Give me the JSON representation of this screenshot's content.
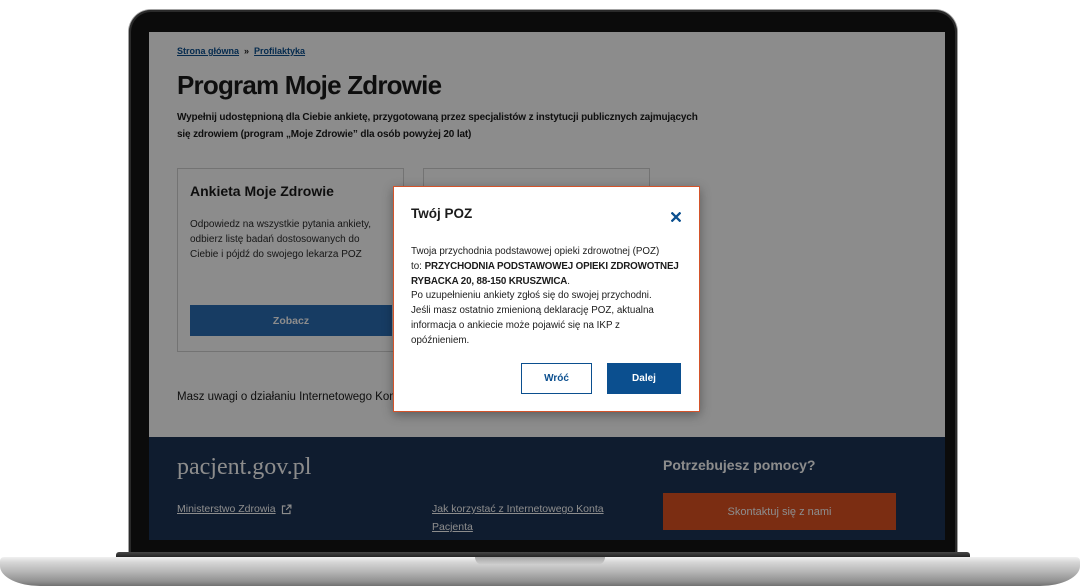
{
  "breadcrumb": {
    "home": "Strona główna",
    "separator": "»",
    "current": "Profilaktyka"
  },
  "page": {
    "title": "Program Moje Zdrowie",
    "subtitle_lines": [
      "Wypełnij udostępnioną dla Ciebie ankietę, przygotowaną przez specjalistów z instytucji publicznych zajmujących",
      "się zdrowiem (program „Moje Zdrowie” dla osób powyżej 20 lat)"
    ],
    "cards": [
      {
        "title": "Ankieta Moje Zdrowie",
        "description": "Odpowiedz na wszystkie pytania ankiety, odbierz listę badań dostosowanych do Ciebie i pójdź do swojego lekarza POZ",
        "button_label": "Zobacz"
      }
    ],
    "feedback_text": "Masz uwagi o działaniu Internetowego Kon"
  },
  "footer": {
    "logo_text": "pacjent.gov.pl",
    "ministry_link": "Ministerstwo Zdrowia",
    "help_link": "Jak korzystać z Internetowego Konta Pacjenta",
    "help_heading": "Potrzebujesz pomocy?",
    "contact_button_label": "Skontaktuj się z nami"
  },
  "modal": {
    "title": "Twój POZ",
    "body": {
      "line1": "Twoja przychodnia podstawowej opieki zdrowotnej (POZ)",
      "to_prefix": "to:",
      "clinic_name": "PRZYCHODNIA PODSTAWOWEJ OPIEKI ZDROWOTNEJ",
      "clinic_address": "RYBACKA 20, 88-150 KRUSZWICA",
      "clinic_end": ".",
      "line4": "Po uzupełnieniu ankiety zgłoś się do swojej przychodni.",
      "line5": "Jeśli masz ostatnio zmienioną deklarację POZ, aktualna",
      "line6": "informacja o ankiecie może pojawić się na IKP z",
      "line7": "opóźnieniem."
    },
    "back_label": "Wróć",
    "next_label": "Dalej"
  },
  "icons": {
    "modal_close": "close-icon",
    "ministry_link": "external-link-icon"
  },
  "colors": {
    "primary_blue": "#0b4f8f",
    "footer_navy": "#1c3356",
    "contact_orange": "#e05222",
    "modal_border": "#d4532a"
  }
}
